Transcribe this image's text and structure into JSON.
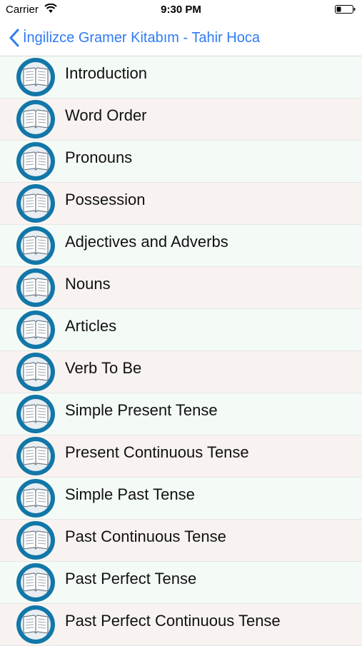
{
  "status_bar": {
    "carrier": "Carrier",
    "time": "9:30 PM",
    "wifi_icon": "wifi-icon",
    "battery_icon": "battery-icon"
  },
  "nav": {
    "back_label": "İngilizce Gramer Kitabım - Tahir Hoca",
    "back_icon": "chevron-left-icon",
    "accent_color": "#2f7bf5"
  },
  "topics": {
    "icon": "open-book-icon",
    "icon_color": "#1277a8",
    "items": [
      {
        "label": "Introduction"
      },
      {
        "label": "Word Order"
      },
      {
        "label": "Pronouns"
      },
      {
        "label": "Possession"
      },
      {
        "label": "Adjectives and Adverbs"
      },
      {
        "label": "Nouns"
      },
      {
        "label": "Articles"
      },
      {
        "label": "Verb To Be"
      },
      {
        "label": "Simple Present Tense"
      },
      {
        "label": "Present Continuous Tense"
      },
      {
        "label": "Simple Past Tense"
      },
      {
        "label": "Past Continuous Tense"
      },
      {
        "label": "Past Perfect Tense"
      },
      {
        "label": "Past Perfect Continuous Tense"
      }
    ]
  }
}
